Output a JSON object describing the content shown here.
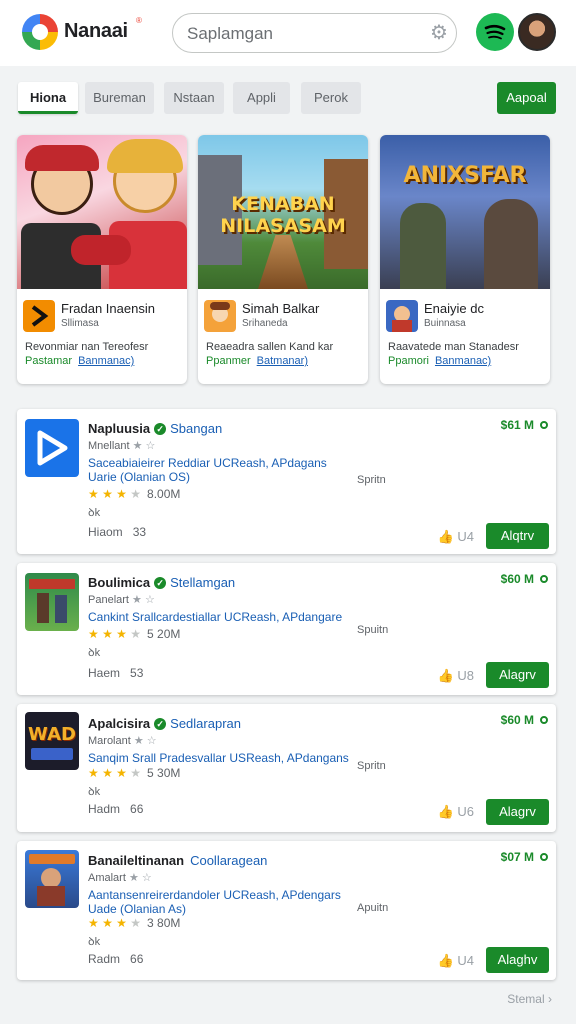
{
  "header": {
    "brand": "Nanaai",
    "brand_sup": "®",
    "search_placeholder": "Saplamgan"
  },
  "tabs": [
    {
      "label": "Hiona",
      "active": true
    },
    {
      "label": "Bureman",
      "active": false
    },
    {
      "label": "Nstaan",
      "active": false
    },
    {
      "label": "Appli",
      "active": false
    },
    {
      "label": "Perok",
      "active": false
    }
  ],
  "tab_action": "Aapoal",
  "featured": [
    {
      "image_title": "",
      "name": "Fradan Inaensin",
      "dev": "Sllimasa",
      "desc": "Revonmiar nan Tereofesr",
      "price": "Pastamar",
      "link": "Banmanac)"
    },
    {
      "image_title": "KENABAN NILASASAM",
      "name": "Simah Balkar",
      "dev": "Srihaneda",
      "desc": "Reaeadra sallen Kand kar",
      "price": "Ppanmer",
      "link": "Batmanar)"
    },
    {
      "image_title": "ANIXSFAR",
      "name": "Enaiyie dc",
      "dev": "Buinnasa",
      "desc": "Raavatede man Stanadesr",
      "price": "Ppamori",
      "link": "Banmanac)"
    }
  ],
  "apps": [
    {
      "title": "Napluusia",
      "subtitle": "Sbangan",
      "dev": "Mnellant",
      "desc1": "Saceabiaieirer Reddiar UCReash, APdagans",
      "desc2": "Uarie (Olanian OS)",
      "downloads": "8.00M",
      "symbol": "ꝺk",
      "meta_label": "Hiaom",
      "meta_value": "33",
      "platform": "Spritn",
      "price": "$61 M",
      "likes": "U4",
      "install": "Alqtrv"
    },
    {
      "title": "Boulimica",
      "subtitle": "Stellamgan",
      "dev": "Panelart",
      "desc1": "Cankint Srallcardestiallar UCReash, APdangare",
      "desc2": "",
      "downloads": "5 20M",
      "symbol": "ꝺk",
      "meta_label": "Haem",
      "meta_value": "53",
      "platform": "Spuitn",
      "price": "$60 M",
      "likes": "U8",
      "install": "Alagrv"
    },
    {
      "title": "Apalcisira",
      "subtitle": "Sedlarapran",
      "dev": "Marolant",
      "desc1": "Sanqim Srall Pradesvallar USReash, APdangans",
      "desc2": "",
      "downloads": "5 30M",
      "symbol": "ꝺk",
      "meta_label": "Hadm",
      "meta_value": "66",
      "platform": "Spritn",
      "price": "$60 M",
      "likes": "U6",
      "install": "Alagrv"
    },
    {
      "title": "Banaileltinanan",
      "subtitle": "Coollaragean",
      "dev": "Amalart",
      "desc1": "Aantansenreirerdandoler UCReash, APdengars",
      "desc2": "Uade (Olanian As)",
      "downloads": "3 80M",
      "symbol": "ꝺk",
      "meta_label": "Radm",
      "meta_value": "66",
      "platform": "Apuitn",
      "price": "$07 M",
      "likes": "U4",
      "install": "Alaghv"
    }
  ],
  "footer_link": "Stemal",
  "colors": {
    "accent": "#1a8a2a",
    "link": "#1a5fb4"
  }
}
